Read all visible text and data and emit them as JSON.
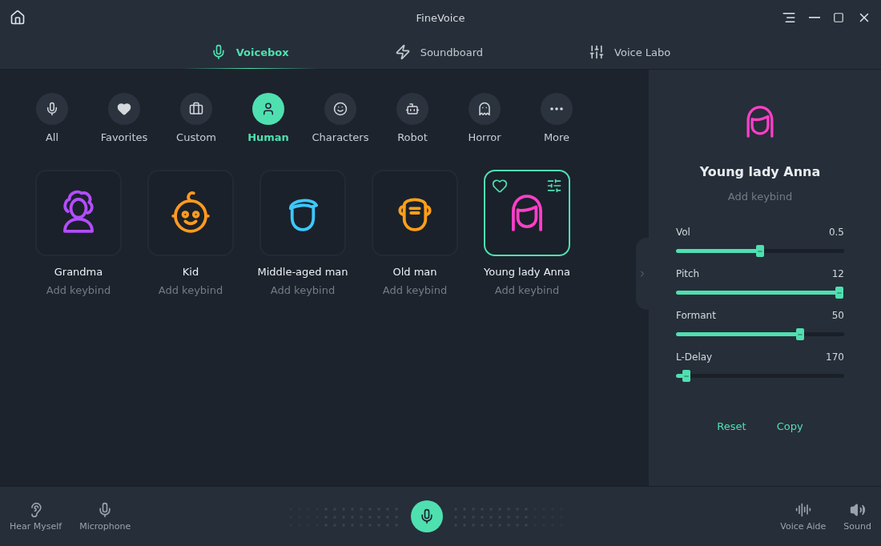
{
  "window": {
    "title": "FineVoice"
  },
  "tabs": [
    {
      "label": "Voicebox",
      "selected": true
    },
    {
      "label": "Soundboard",
      "selected": false
    },
    {
      "label": "Voice Labo",
      "selected": false
    }
  ],
  "categories": [
    {
      "label": "All",
      "selected": false
    },
    {
      "label": "Favorites",
      "selected": false
    },
    {
      "label": "Custom",
      "selected": false
    },
    {
      "label": "Human",
      "selected": true
    },
    {
      "label": "Characters",
      "selected": false
    },
    {
      "label": "Robot",
      "selected": false
    },
    {
      "label": "Horror",
      "selected": false
    },
    {
      "label": "More",
      "selected": false
    }
  ],
  "voices": [
    {
      "name": "Grandma",
      "keybind": "Add keybind",
      "kind": "grandma",
      "color": "#b44dff",
      "selected": false
    },
    {
      "name": "Kid",
      "keybind": "Add keybind",
      "kind": "kid",
      "color": "#ff9a1f",
      "selected": false
    },
    {
      "name": "Middle-aged man",
      "keybind": "Add keybind",
      "kind": "man",
      "color": "#3cc8ff",
      "selected": false
    },
    {
      "name": "Old man",
      "keybind": "Add keybind",
      "kind": "oldman",
      "color": "#ff9f1a",
      "selected": false
    },
    {
      "name": "Young lady Anna",
      "keybind": "Add keybind",
      "kind": "lady",
      "color": "#ff3fc8",
      "selected": true
    }
  ],
  "detail": {
    "name": "Young lady Anna",
    "keybind": "Add keybind",
    "kind": "lady",
    "color": "#ff3fc8",
    "sliders": [
      {
        "label": "Vol",
        "reading": "0.5",
        "level": 0.5
      },
      {
        "label": "Pitch",
        "reading": "12",
        "level": 0.97
      },
      {
        "label": "Formant",
        "reading": "50",
        "level": 0.74
      },
      {
        "label": "L-Delay",
        "reading": "170",
        "level": 0.06
      }
    ],
    "buttons": [
      "Reset",
      "Copy"
    ]
  },
  "bottom_bar": {
    "left": [
      "Hear Myself",
      "Microphone"
    ],
    "right": [
      "Voice Aide",
      "Sound"
    ]
  }
}
